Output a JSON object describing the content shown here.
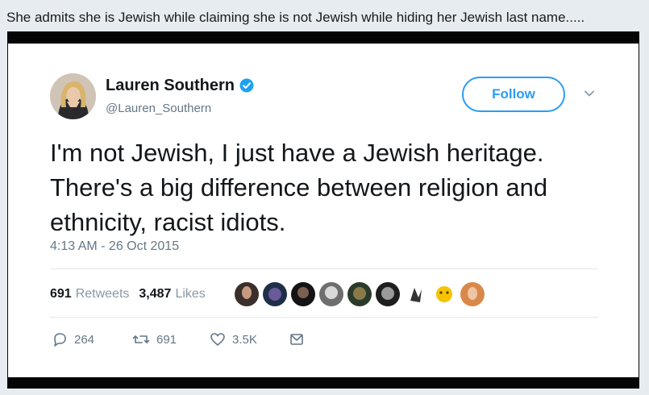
{
  "caption": "She admits she is Jewish while claiming she is not Jewish while hiding her Jewish last name.....",
  "tweet": {
    "display_name": "Lauren Southern",
    "handle": "@Lauren_Southern",
    "verified": true,
    "follow_label": "Follow",
    "text": "I'm not Jewish, I just have a Jewish heritage. There's a big difference between religion and ethnicity, racist idiots.",
    "timestamp": "4:13 AM - 26 Oct 2015",
    "stats": {
      "retweets_count": "691",
      "retweets_label": "Retweets",
      "likes_count": "3,487",
      "likes_label": "Likes"
    },
    "actions": {
      "reply_count": "264",
      "retweet_count": "691",
      "like_count": "3.5K"
    }
  },
  "colors": {
    "accent": "#2a9df4",
    "text": "#14171a",
    "muted": "#657786",
    "background": "#e7ecf1"
  }
}
